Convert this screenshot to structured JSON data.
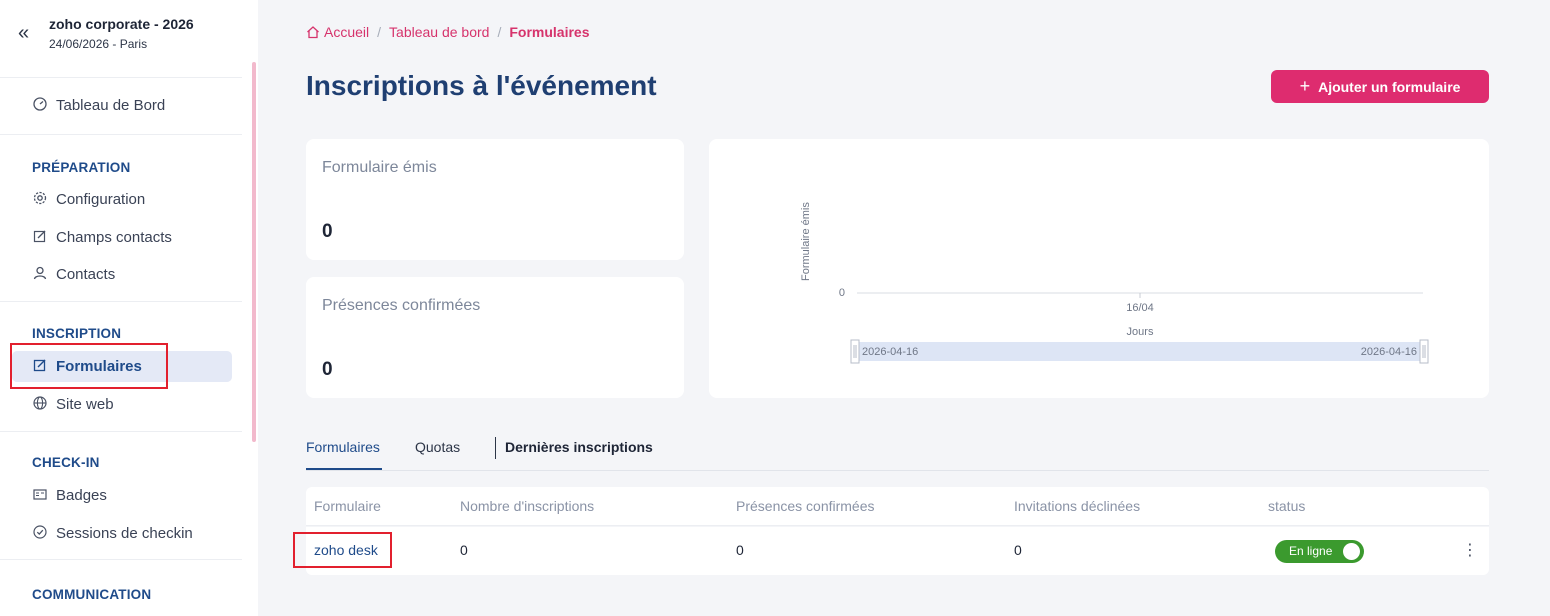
{
  "sidebar": {
    "collapse_icon": "«",
    "event_name": "zoho corporate - 2026",
    "event_date": "24/06/2026 - Paris",
    "dashboard": "Tableau de Bord",
    "sections": {
      "preparation": "PRÉPARATION",
      "inscription": "INSCRIPTION",
      "checkin": "CHECK-IN",
      "communication": "COMMUNICATION"
    },
    "items": {
      "configuration": "Configuration",
      "champs_contacts": "Champs contacts",
      "contacts": "Contacts",
      "formulaires": "Formulaires",
      "site_web": "Site web",
      "badges": "Badges",
      "sessions_checkin": "Sessions de checkin"
    }
  },
  "breadcrumb": {
    "home": "Accueil",
    "dashboard": "Tableau de bord",
    "current": "Formulaires",
    "separator": "/"
  },
  "page_title": "Inscriptions à l'événement",
  "add_button": {
    "icon": "+",
    "label": "Ajouter un formulaire"
  },
  "stats": {
    "issued_label": "Formulaire émis",
    "issued_value": "0",
    "confirmed_label": "Présences confirmées",
    "confirmed_value": "0"
  },
  "chart_data": {
    "type": "line",
    "ylabel": "Formulaire émis",
    "xlabel": "Jours",
    "x": [
      "16/04"
    ],
    "series": [
      {
        "values": [
          0
        ]
      }
    ],
    "y_ticks": [
      "0"
    ],
    "range_start": "2026-04-16",
    "range_end": "2026-04-16"
  },
  "tabs": [
    "Formulaires",
    "Quotas",
    "Dernières inscriptions"
  ],
  "table": {
    "headers": [
      "Formulaire",
      "Nombre d'inscriptions",
      "Présences confirmées",
      "Invitations déclinées",
      "status"
    ],
    "rows": [
      {
        "form": "zoho desk",
        "registrations": "0",
        "confirmed": "0",
        "declined": "0",
        "status": "En ligne"
      }
    ]
  },
  "colors": {
    "accent": "#de2c6f",
    "primary": "#1f4b8a",
    "status_online": "#3b9a2e"
  }
}
